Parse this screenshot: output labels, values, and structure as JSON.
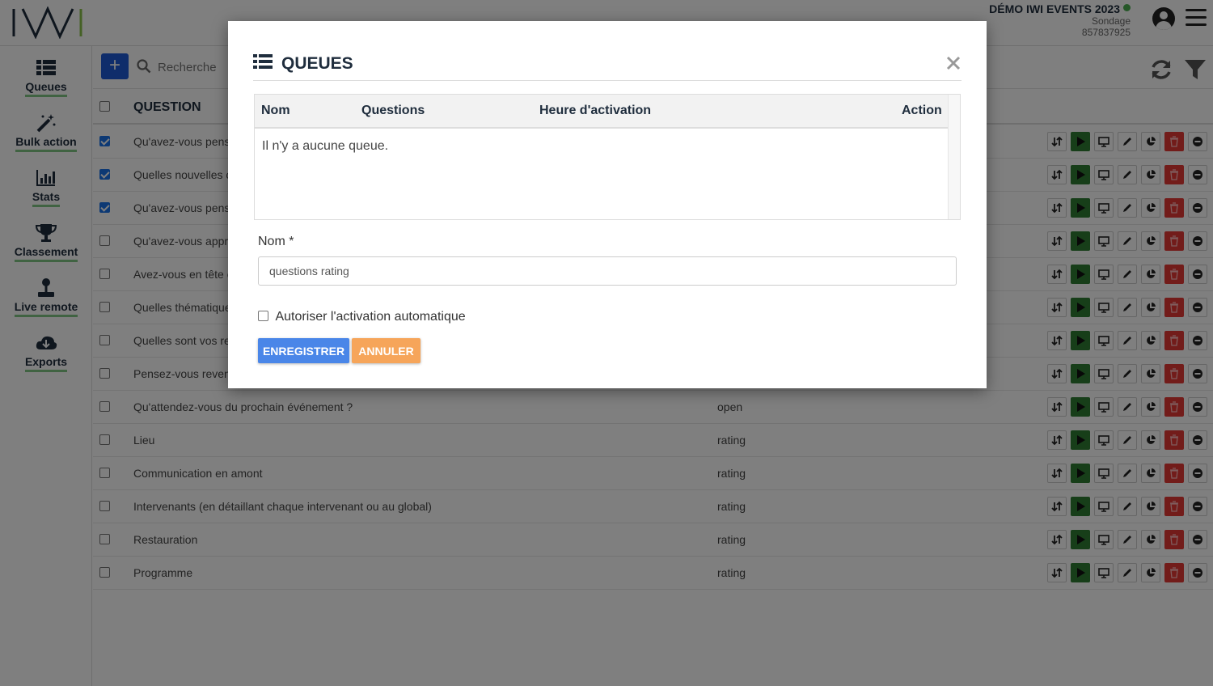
{
  "header": {
    "event_title": "DÉMO IWI EVENTS 2023",
    "event_type": "Sondage",
    "event_code": "857837925",
    "status_color": "#4caf50"
  },
  "sidebar": {
    "items": [
      {
        "label": "Queues",
        "icon": "list-icon"
      },
      {
        "label": "Bulk action",
        "icon": "magic-wand-icon"
      },
      {
        "label": "Stats",
        "icon": "bar-chart-icon"
      },
      {
        "label": "Classement",
        "icon": "trophy-icon"
      },
      {
        "label": "Live remote",
        "icon": "joystick-icon"
      },
      {
        "label": "Exports",
        "icon": "cloud-download-icon"
      }
    ]
  },
  "toolbar": {
    "add_label": "+",
    "search_placeholder": "Recherche"
  },
  "table": {
    "header_question": "QUESTION",
    "rows": [
      {
        "question": "Qu'avez-vous pensé",
        "type": "",
        "checked": true
      },
      {
        "question": "Quelles nouvelles c",
        "type": "",
        "checked": true
      },
      {
        "question": "Qu'avez-vous pensé",
        "type": "",
        "checked": true
      },
      {
        "question": "Qu'avez-vous appré",
        "type": "",
        "checked": false
      },
      {
        "question": "Avez-vous en tête c",
        "type": "",
        "checked": false
      },
      {
        "question": "Quelles thématique",
        "type": "",
        "checked": false
      },
      {
        "question": "Quelles sont vos re",
        "type": "",
        "checked": false
      },
      {
        "question": "Pensez-vous revenir",
        "type": "",
        "checked": false
      },
      {
        "question": "Qu'attendez-vous du prochain événement ?",
        "type": "open",
        "checked": false
      },
      {
        "question": "Lieu",
        "type": "rating",
        "checked": false
      },
      {
        "question": "Communication en amont",
        "type": "rating",
        "checked": false
      },
      {
        "question": "Intervenants (en détaillant chaque intervenant ou au global)",
        "type": "rating",
        "checked": false
      },
      {
        "question": "Restauration",
        "type": "rating",
        "checked": false
      },
      {
        "question": "Programme",
        "type": "rating",
        "checked": false
      }
    ]
  },
  "modal": {
    "title": "QUEUES",
    "columns": [
      "Nom",
      "Questions",
      "Heure d'activation",
      "Action"
    ],
    "empty_text": "Il n'y a aucune queue.",
    "name_label": "Nom *",
    "name_value": "questions rating",
    "auto_label": "Autoriser l'activation automatique",
    "save_label": "ENREGISTRER",
    "cancel_label": "ANNULER"
  },
  "colors": {
    "primary": "#1e5bd6",
    "save": "#4a86e8",
    "cancel": "#f6a55a",
    "play": "#2e7d32",
    "delete": "#e53935",
    "accent_underline": "#81c784"
  }
}
